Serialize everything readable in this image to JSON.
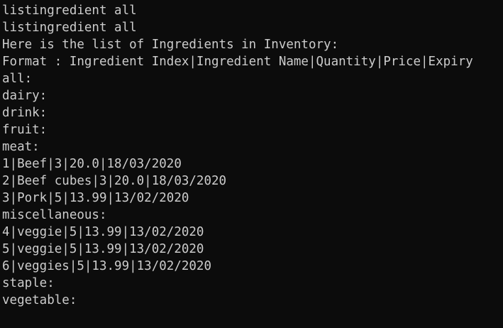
{
  "terminal": {
    "lines": [
      "listingredient all",
      "listingredient all",
      "Here is the list of Ingredients in Inventory:",
      "Format : Ingredient Index|Ingredient Name|Quantity|Price|Expiry",
      "all:",
      "dairy:",
      "drink:",
      "fruit:",
      "meat:",
      "1|Beef|3|20.0|18/03/2020",
      "2|Beef cubes|3|20.0|18/03/2020",
      "3|Pork|5|13.99|13/02/2020",
      "miscellaneous:",
      "4|veggie|5|13.99|13/02/2020",
      "5|veggie|5|13.99|13/02/2020",
      "6|veggies|5|13.99|13/02/2020",
      "staple:",
      "vegetable:"
    ],
    "colors": {
      "background": "#0c0c0c",
      "text": "#cccccc"
    }
  }
}
